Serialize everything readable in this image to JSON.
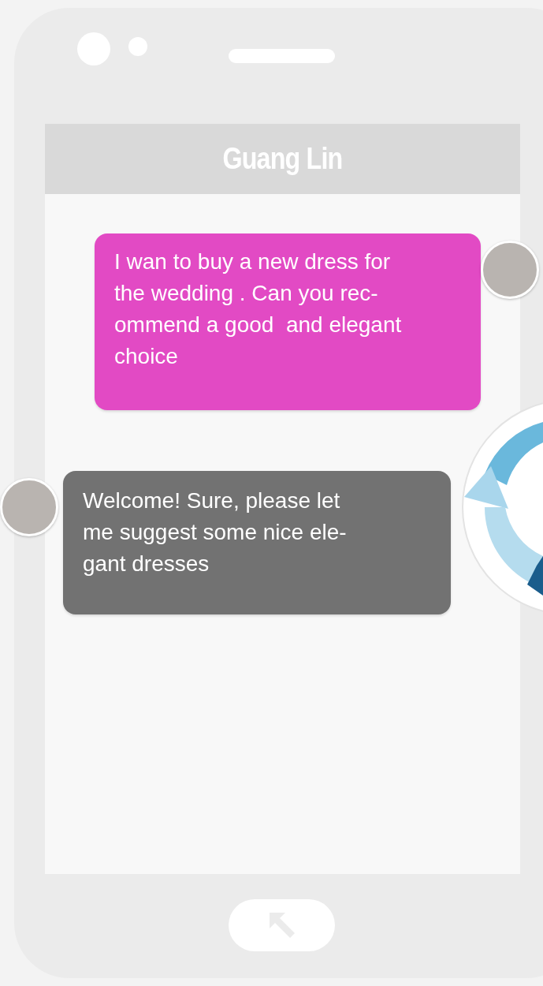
{
  "header": {
    "title": "Guang Lin"
  },
  "messages": [
    {
      "kind": "outgoing",
      "text": "I wan to buy a new dress for\nthe wedding . Can you rec-\nommend a good  and elegant\nchoice"
    },
    {
      "kind": "incoming",
      "text": "Welcome! Sure, please let\nme suggest some nice ele-\ngant dresses"
    }
  ]
}
